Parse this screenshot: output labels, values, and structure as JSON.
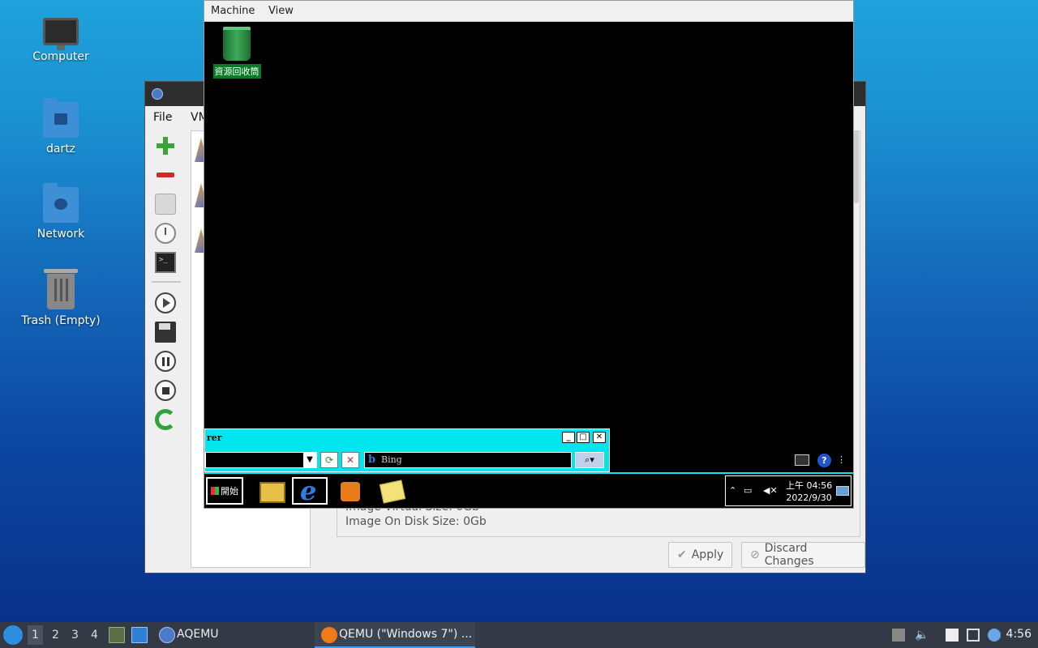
{
  "desktop": {
    "icons": [
      {
        "label": "Computer",
        "icon": "computer-icon"
      },
      {
        "label": "dartz",
        "icon": "home-folder-icon"
      },
      {
        "label": "Network",
        "icon": "network-folder-icon"
      },
      {
        "label": "Trash (Empty)",
        "icon": "trash-icon"
      }
    ]
  },
  "aqemu": {
    "menu": {
      "file": "File",
      "vm": "VM"
    },
    "details": {
      "line1": "Image Virtual Size: 0Gb",
      "line2": "Image On Disk Size: 0Gb"
    },
    "buttons": {
      "apply": "Apply",
      "discard": "Discard Changes"
    }
  },
  "qemu": {
    "menu": {
      "machine": "Machine",
      "view": "View"
    },
    "guest": {
      "recycle_bin": "資源回收筒",
      "ie_title": "rer",
      "search_provider": "Bing",
      "start_label": "開始",
      "clock_time": "上午 04:56",
      "clock_date": "2022/9/30"
    }
  },
  "taskbar": {
    "workspaces": [
      "1",
      "2",
      "3",
      "4"
    ],
    "active_workspace": "1",
    "aqemu_task": "AQEMU",
    "qemu_task": "QEMU (\"Windows 7\") ...",
    "time": "4:56"
  },
  "colors": {
    "guest_accent": "#00e5ee",
    "taskbar_bg": "#333a45",
    "active_task_underline": "#3d9cf0"
  }
}
